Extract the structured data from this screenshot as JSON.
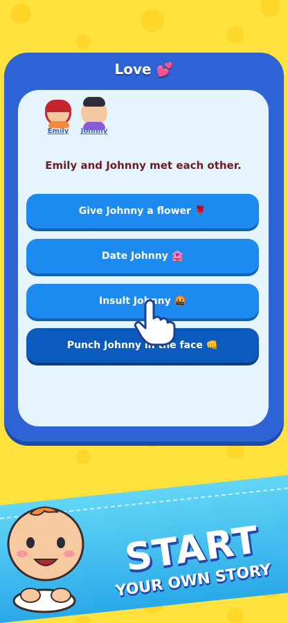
{
  "header": {
    "title": "Love 💕"
  },
  "characters": [
    {
      "name": "Emily"
    },
    {
      "name": "Johnny"
    }
  ],
  "story": {
    "text": "Emily and Johnny met each other."
  },
  "choices": [
    {
      "label": "Give Johnny a flower 🌹"
    },
    {
      "label": "Date Johnny 🏩"
    },
    {
      "label": "Insult Johnny 🤬"
    },
    {
      "label": "Punch Johnny in the face 👊"
    }
  ],
  "promo": {
    "headline": "START",
    "tagline": "YOUR OWN STORY"
  },
  "colors": {
    "background": "#ffe23d",
    "card": "#2e63d6",
    "card_inner": "#e5f3fd",
    "choice": "#1c8aef",
    "choice_selected": "#0a5bbd",
    "story_text": "#6b1d22"
  },
  "icons": [
    "hand-pointer-icon",
    "baby-icon"
  ]
}
